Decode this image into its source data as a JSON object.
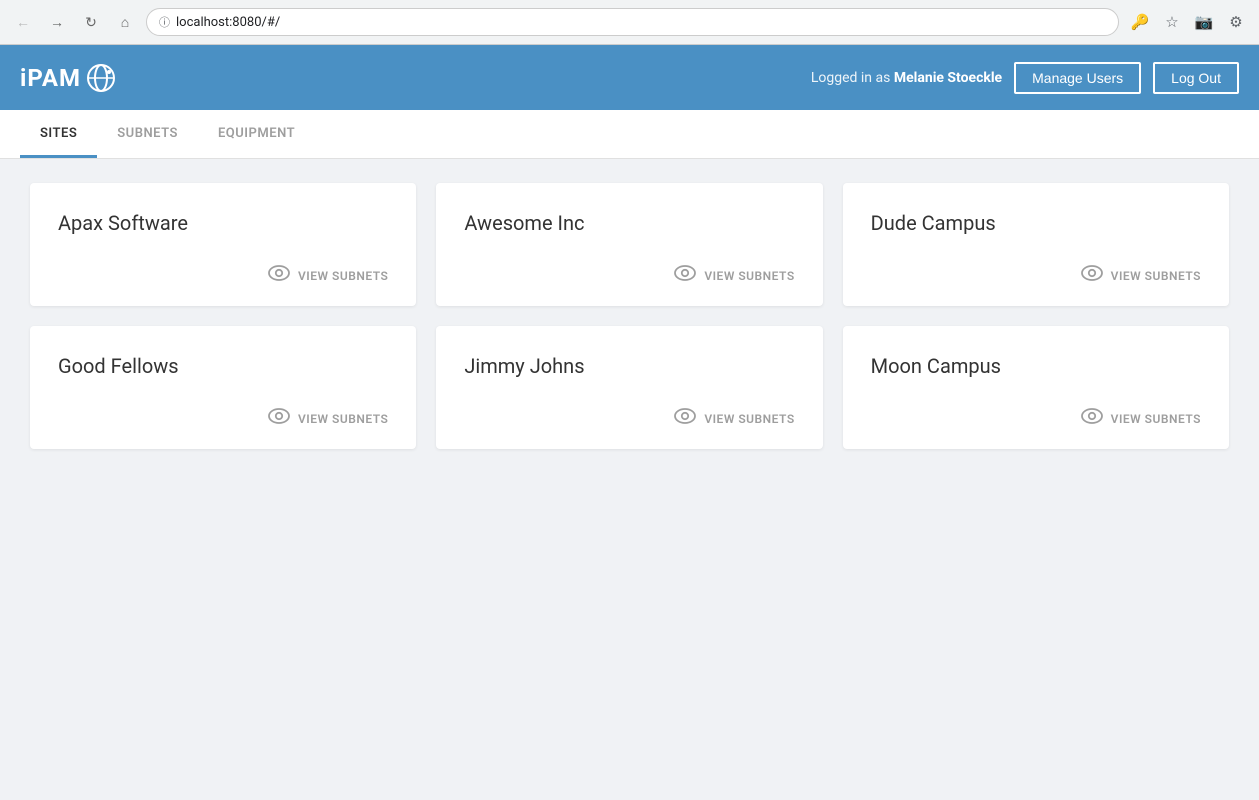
{
  "browser": {
    "url": "localhost:8080/#/",
    "url_icon": "🔒"
  },
  "header": {
    "logo_text": "iPAM",
    "logged_in_prefix": "Logged in as ",
    "user_name": "Melanie Stoeckle",
    "manage_users_label": "Manage Users",
    "logout_label": "Log Out"
  },
  "tabs": [
    {
      "id": "sites",
      "label": "SITES",
      "active": true
    },
    {
      "id": "subnets",
      "label": "SUBNETS",
      "active": false
    },
    {
      "id": "equipment",
      "label": "EQUIPMENT",
      "active": false
    }
  ],
  "sites": [
    {
      "id": "apax-software",
      "name": "Apax Software",
      "view_subnets_label": "VIEW SUBNETS"
    },
    {
      "id": "awesome-inc",
      "name": "Awesome Inc",
      "view_subnets_label": "VIEW SUBNETS"
    },
    {
      "id": "dude-campus",
      "name": "Dude Campus",
      "view_subnets_label": "VIEW SUBNETS"
    },
    {
      "id": "good-fellows",
      "name": "Good Fellows",
      "view_subnets_label": "VIEW SUBNETS"
    },
    {
      "id": "jimmy-johns",
      "name": "Jimmy Johns",
      "view_subnets_label": "VIEW SUBNETS"
    },
    {
      "id": "moon-campus",
      "name": "Moon Campus",
      "view_subnets_label": "VIEW SUBNETS"
    }
  ],
  "colors": {
    "header_bg": "#4a90c4",
    "active_tab_underline": "#4a90c4"
  }
}
